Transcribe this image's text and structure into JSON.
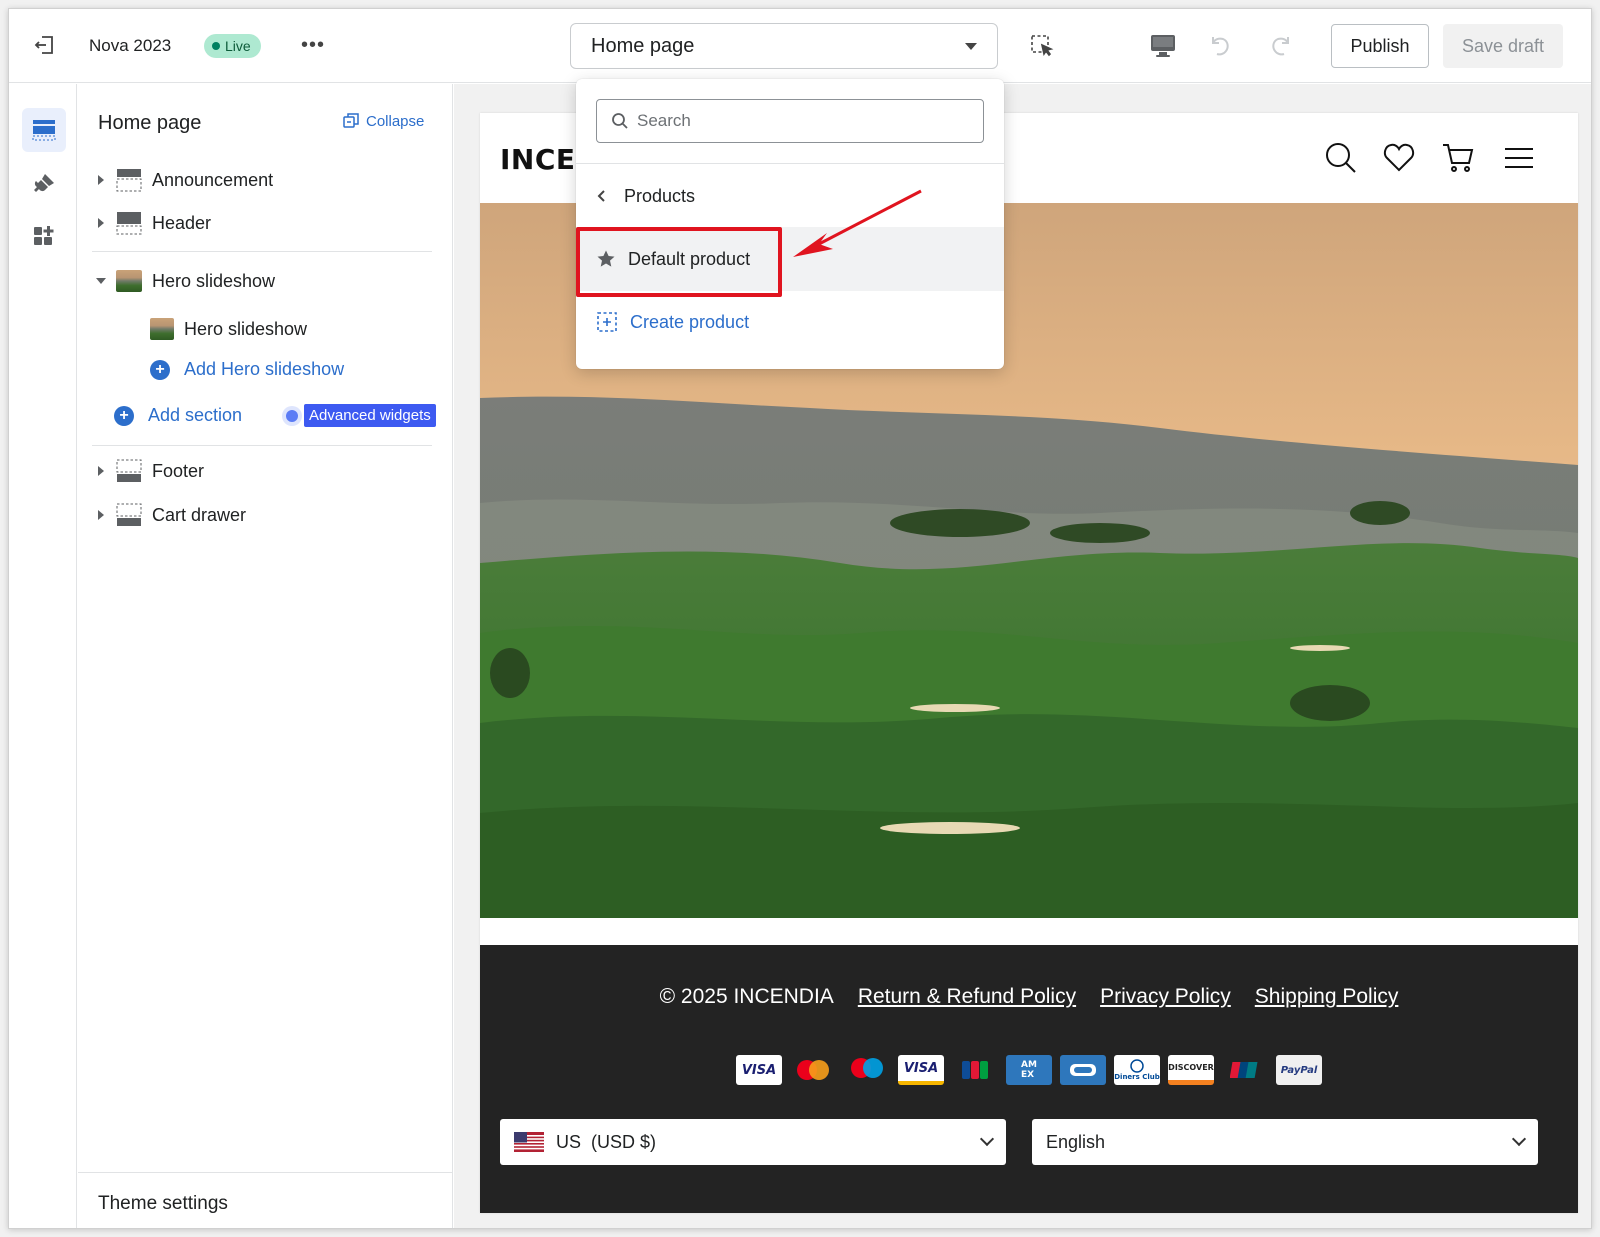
{
  "topbar": {
    "store_name": "Nova 2023",
    "live_label": "Live",
    "more_label": "•••",
    "page_selector": "Home page",
    "publish_label": "Publish",
    "save_draft_label": "Save draft"
  },
  "dropdown": {
    "search_placeholder": "Search",
    "back_label": "Products",
    "selected_item": "Default product",
    "create_label": "Create product"
  },
  "sidebar": {
    "title": "Home page",
    "collapse_label": "Collapse",
    "sections": {
      "announcement": "Announcement",
      "header": "Header",
      "hero_slideshow": "Hero slideshow",
      "hero_slide": "Hero slideshow",
      "add_hero_slideshow": "Add Hero slideshow",
      "add_section": "Add section",
      "advanced_widgets": "Advanced widgets",
      "footer": "Footer",
      "cart_drawer": "Cart drawer"
    },
    "theme_settings": "Theme settings"
  },
  "preview": {
    "logo": "INCEN",
    "footer": {
      "copyright": "© 2025 INCENDIA",
      "links": [
        "Return & Refund Policy",
        "Privacy Policy",
        "Shipping Policy"
      ],
      "payments": [
        "VISA",
        "mastercard",
        "maestro",
        "VISA",
        "JCB",
        "AMEX",
        "card",
        "Diners Club",
        "DISCOVER",
        "UnionPay",
        "PayPal"
      ],
      "currency": "US  (USD $)",
      "language": "English"
    }
  },
  "colors": {
    "accent_blue": "#2c6ecb",
    "highlight_red": "#e0141f",
    "live_badge": "#aee9d1",
    "footer_bg": "#232323"
  }
}
